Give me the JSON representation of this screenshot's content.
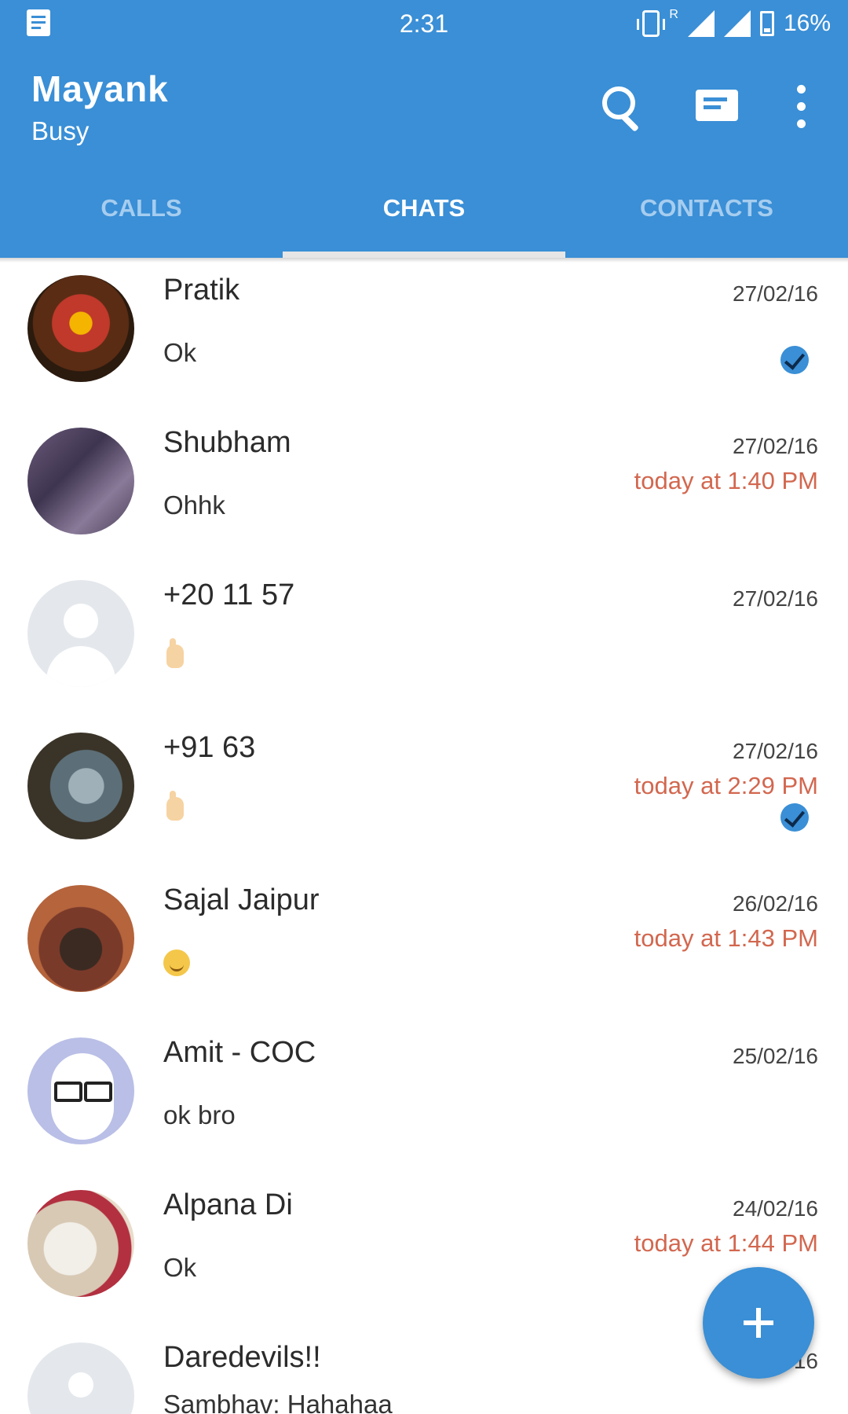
{
  "status_bar": {
    "time": "2:31",
    "network": "R",
    "battery": "16%"
  },
  "header": {
    "name": "Mayank",
    "status": "Busy"
  },
  "tabs": [
    {
      "label": "CALLS"
    },
    {
      "label": "CHATS",
      "active": true
    },
    {
      "label": "CONTACTS"
    }
  ],
  "chats": [
    {
      "name": "Pratik",
      "message": "Ok",
      "date": "27/02/16",
      "read": true
    },
    {
      "name": "Shubham",
      "message": "Ohhk",
      "date": "27/02/16",
      "reminder": "today at 1:40 PM"
    },
    {
      "name": "+20 11 57",
      "message_emoji": "thumbs-up",
      "date": "27/02/16"
    },
    {
      "name": "+91 63",
      "message_emoji": "thumbs-up",
      "date": "27/02/16",
      "reminder": "today at 2:29 PM",
      "read": true
    },
    {
      "name": "Sajal Jaipur",
      "message_emoji": "smiley",
      "date": "26/02/16",
      "reminder": "today at 1:43 PM"
    },
    {
      "name": "Amit - COC",
      "message": "ok bro",
      "date": "25/02/16"
    },
    {
      "name": "Alpana Di",
      "message": "Ok",
      "date": "24/02/16",
      "reminder": "today at 1:44 PM"
    },
    {
      "name": "Daredevils!!",
      "message": "Sambhav: Hahahaa",
      "date": "16"
    }
  ],
  "colors": {
    "primary": "#3a8fd6",
    "reminder": "#d2674f"
  },
  "icons": [
    "search-icon",
    "compose-icon",
    "more-options-icon",
    "add-icon"
  ]
}
